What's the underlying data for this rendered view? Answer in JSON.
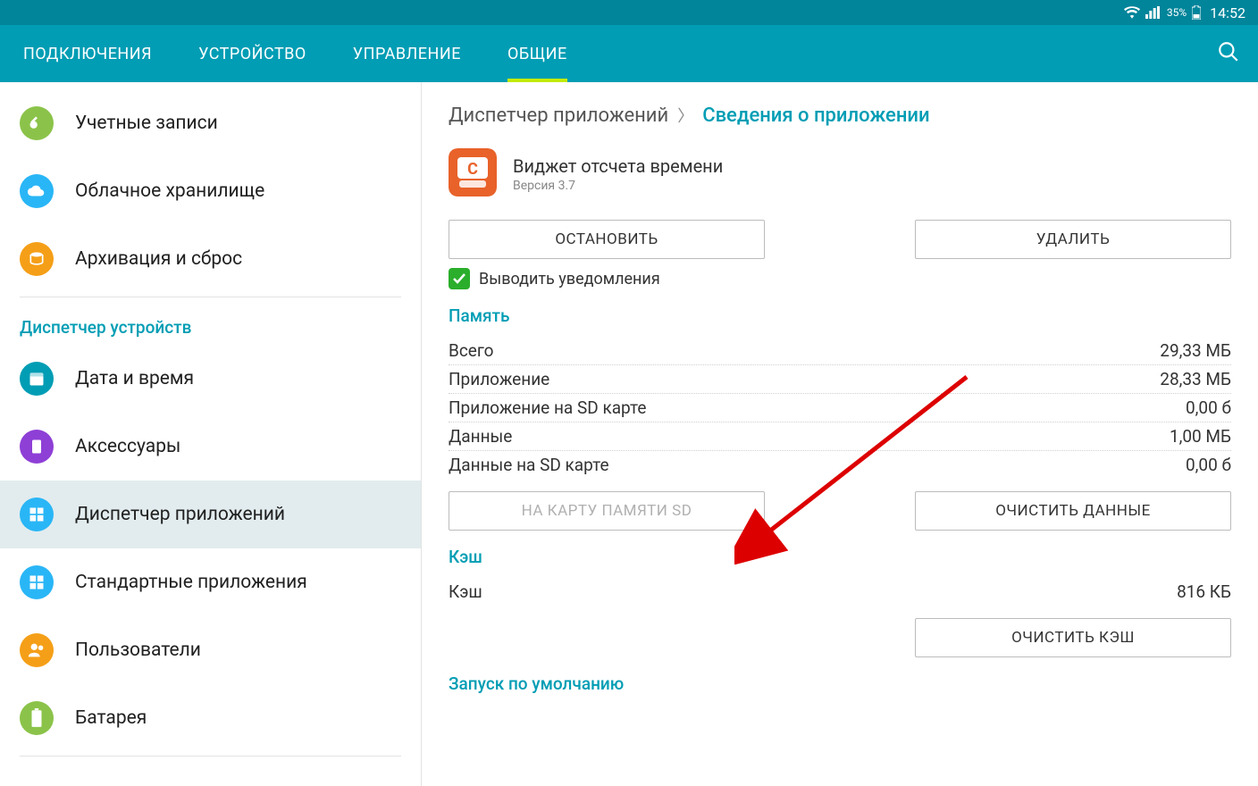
{
  "statusbar": {
    "battery_pct": "35%",
    "clock": "14:52"
  },
  "tabs": {
    "items": [
      {
        "label": "ПОДКЛЮЧЕНИЯ"
      },
      {
        "label": "УСТРОЙСТВО"
      },
      {
        "label": "УПРАВЛЕНИЕ"
      },
      {
        "label": "ОБЩИЕ"
      }
    ],
    "active_index": 3
  },
  "sidebar": {
    "groups": [
      {
        "items": [
          {
            "label": "Учетные записи",
            "color": "#8bc34a",
            "icon": "key"
          },
          {
            "label": "Облачное хранилище",
            "color": "#29b6f6",
            "icon": "cloud"
          },
          {
            "label": "Архивация и сброс",
            "color": "#f59f18",
            "icon": "backup"
          }
        ]
      },
      {
        "header": "Диспетчер устройств",
        "items": [
          {
            "label": "Дата и время",
            "color": "#009db4",
            "icon": "clock"
          },
          {
            "label": "Аксессуары",
            "color": "#8e3fd6",
            "icon": "accessory"
          },
          {
            "label": "Диспетчер приложений",
            "color": "#29b6f6",
            "icon": "grid",
            "selected": true
          },
          {
            "label": "Стандартные приложения",
            "color": "#29b6f6",
            "icon": "grid"
          },
          {
            "label": "Пользователи",
            "color": "#f59f18",
            "icon": "users"
          },
          {
            "label": "Батарея",
            "color": "#8bc34a",
            "icon": "battery"
          }
        ]
      }
    ]
  },
  "breadcrumb": {
    "parent": "Диспетчер приложений",
    "current": "Сведения о приложении"
  },
  "app": {
    "name": "Виджет отсчета времени",
    "version": "Версия 3.7"
  },
  "buttons": {
    "stop": "ОСТАНОВИТЬ",
    "uninstall": "УДАЛИТЬ",
    "to_sd": "НА КАРТУ ПАМЯТИ SD",
    "clear_data": "ОЧИСТИТЬ ДАННЫЕ",
    "clear_cache": "ОЧИСТИТЬ КЭШ"
  },
  "checkbox": {
    "label": "Выводить уведомления"
  },
  "sections": {
    "memory": "Память",
    "cache": "Кэш",
    "launch": "Запуск по умолчанию"
  },
  "memory": [
    {
      "k": "Всего",
      "v": "29,33 МБ"
    },
    {
      "k": "Приложение",
      "v": "28,33 МБ"
    },
    {
      "k": "Приложение на SD карте",
      "v": "0,00 б"
    },
    {
      "k": "Данные",
      "v": "1,00 МБ"
    },
    {
      "k": "Данные на SD карте",
      "v": "0,00 б"
    }
  ],
  "cache": [
    {
      "k": "Кэш",
      "v": "816 КБ"
    }
  ]
}
